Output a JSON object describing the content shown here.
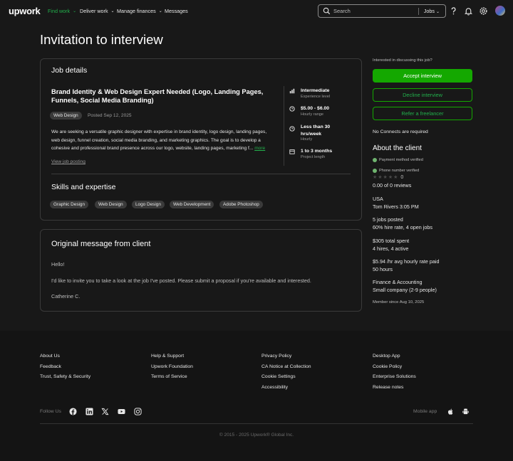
{
  "header": {
    "logo": "upwork",
    "nav": [
      {
        "label": "Find work",
        "active": true
      },
      {
        "label": "Deliver work",
        "active": false
      },
      {
        "label": "Manage finances",
        "active": false
      },
      {
        "label": "Messages",
        "active": false
      }
    ],
    "search": {
      "placeholder": "Search",
      "scope": "Jobs"
    },
    "icons": [
      "help-icon",
      "bell-icon",
      "settings-icon",
      "avatar"
    ]
  },
  "page_title": "Invitation to interview",
  "job": {
    "section_title": "Job details",
    "title_line1": "Brand Identity & Web Design Expert Needed (Logo, Landing Pages,",
    "title_line2": "Funnels, Social Media Branding)",
    "category": "Web Design",
    "posted": "Posted Sep 12, 2025",
    "desc_lines": [
      "We are seeking a versatile graphic designer with expertise in brand identity, logo design, landing pages,",
      "web design, funnel creation, social media branding, and marketing graphics. The goal is to develop a",
      "cohesive and professional brand presence across our logo, website, landing pages, marketing f..."
    ],
    "more": "more",
    "view_posting": "View job posting",
    "meta": [
      {
        "icon": "experience-icon",
        "title": "Intermediate",
        "sub": "Experience level"
      },
      {
        "icon": "clock-icon",
        "title": "$5.00 - $6.00",
        "sub": "Hourly range"
      },
      {
        "icon": "clock-icon",
        "title_line1": "Less than 30",
        "title_line2": "hrs/week",
        "sub": "Hourly"
      },
      {
        "icon": "calendar-icon",
        "title": "1 to 3 months",
        "sub": "Project length"
      }
    ],
    "skills_title": "Skills and expertise",
    "skills": [
      "Graphic Design",
      "Web Design",
      "Logo Design",
      "Web Development",
      "Adobe Photoshop"
    ]
  },
  "message": {
    "title": "Original message from client",
    "greeting": "Hello!",
    "body": "I'd like to invite you to take a look at the job I've posted. Please submit a proposal if you're available and interested.",
    "signature": "Catherine C."
  },
  "sidebar": {
    "prompt": "Interested in discussing this job?",
    "accept": "Accept interview",
    "decline": "Decline interview",
    "refer": "Refer a freelancer",
    "connects": "No Connects are required",
    "about_title": "About the client",
    "payment": "Payment method verified",
    "phone": "Phone number verified",
    "rating": "0",
    "reviews": "0.00 of 0 reviews",
    "country": "USA",
    "city_time": "Tom Rivers 3:05 PM",
    "jobs_posted": "5 jobs posted",
    "hire_rate": "60% hire rate, 4 open jobs",
    "spent": "$305 total spent",
    "hires": "4 hires, 4 active",
    "avg_rate": "$5.94 /hr avg hourly rate paid",
    "hours": "50 hours",
    "industry": "Finance & Accounting",
    "company": "Small company (2-9 people)",
    "member_since": "Member since Aug 10, 2025"
  },
  "footer": {
    "col1": [
      "About Us",
      "Feedback",
      "Trust, Safety & Security"
    ],
    "col2": [
      "Help & Support",
      "Upwork Foundation",
      "Terms of Service"
    ],
    "col3": [
      "Privacy Policy",
      "CA Notice at Collection",
      "Cookie Settings",
      "Accessibility"
    ],
    "col4": [
      "Desktop App",
      "Cookie Policy",
      "Enterprise Solutions",
      "Release notes"
    ],
    "follow": "Follow Us",
    "mobile": "Mobile app",
    "copyright": "© 2015 - 2025 Upwork® Global Inc."
  },
  "colors": {
    "accent": "#14a800",
    "background": "#181818",
    "card_border": "#3a3a3a"
  }
}
